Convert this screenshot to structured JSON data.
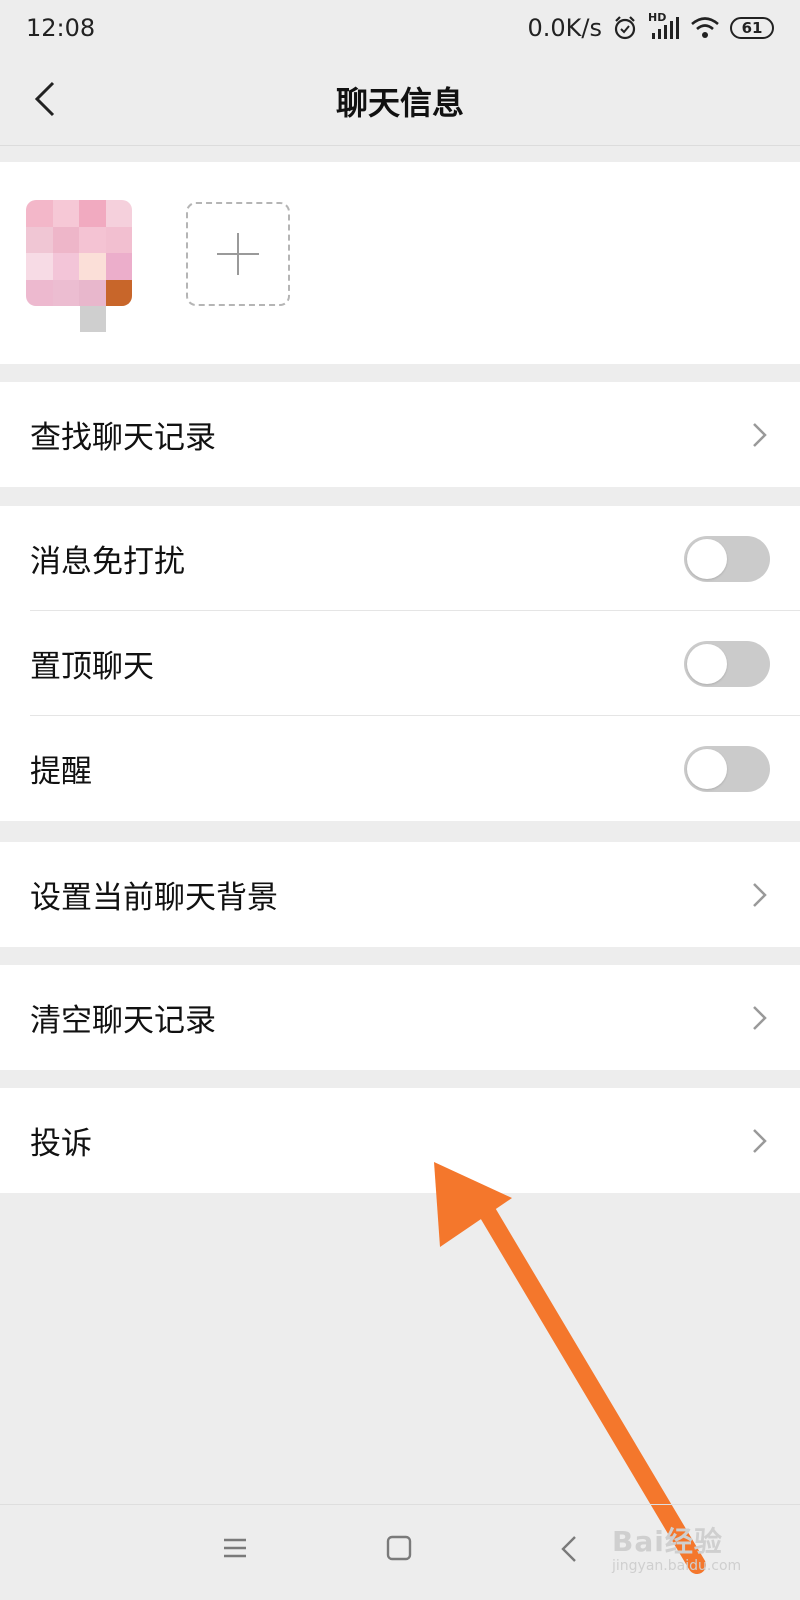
{
  "status_bar": {
    "time": "12:08",
    "speed": "0.0K/s",
    "hd": "HD",
    "battery": "61",
    "icons": [
      "alarm-icon",
      "signal-icon",
      "wifi-icon",
      "battery-icon"
    ]
  },
  "header": {
    "title": "聊天信息",
    "back_icon": "back-chevron-icon"
  },
  "members": {
    "avatar_icon": "pixelated-avatar",
    "add_icon": "plus-icon"
  },
  "settings": {
    "search_history": "查找聊天记录",
    "mute_notifications": "消息免打扰",
    "pin_chat": "置顶聊天",
    "reminder": "提醒",
    "set_background": "设置当前聊天背景",
    "clear_history": "清空聊天记录",
    "report": "投诉"
  },
  "toggles": {
    "mute_notifications": false,
    "pin_chat": false,
    "reminder": false
  },
  "system_nav": {
    "icons": [
      "menu-icon",
      "home-icon",
      "back-icon"
    ]
  },
  "watermark": {
    "main": "Bai经验",
    "sub": "jingyan.baidu.com"
  },
  "colors": {
    "annotation_arrow": "#f4772c",
    "toggle_off": "#cbcbcb",
    "background": "#ededed"
  }
}
